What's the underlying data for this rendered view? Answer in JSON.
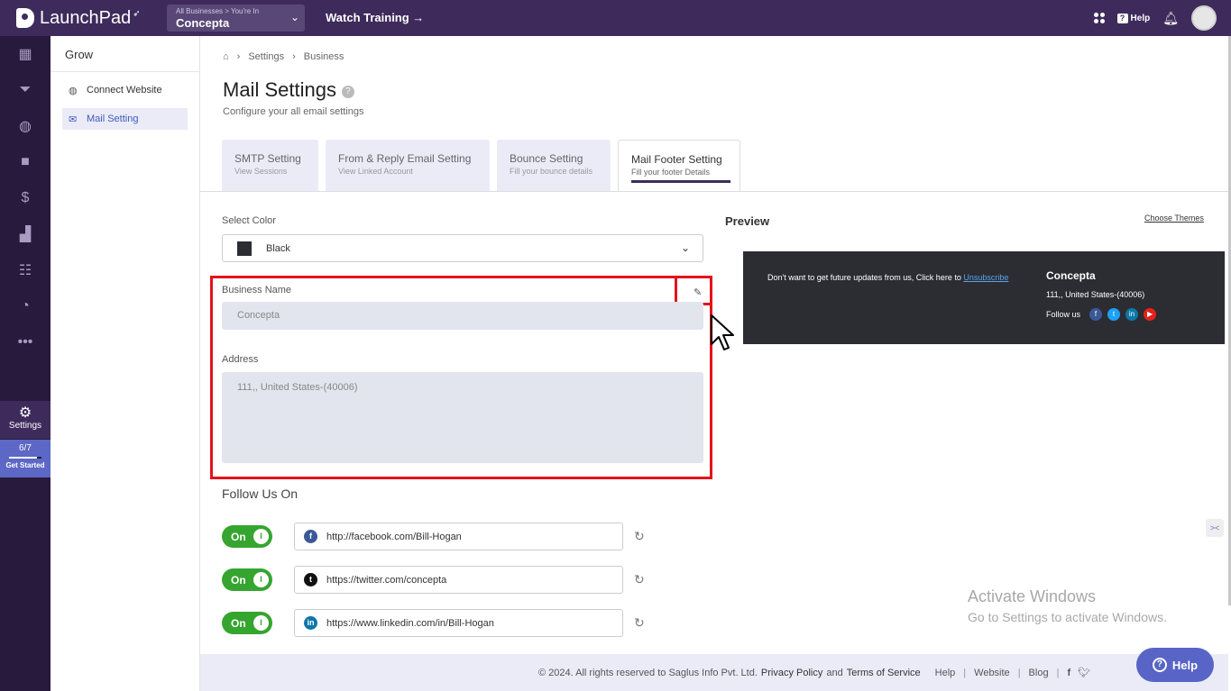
{
  "app": {
    "logo_text": "LaunchPad",
    "business_selector": {
      "caption": "All Businesses > You're In",
      "value": "Concepta"
    },
    "watch_training": "Watch Training →",
    "help_label": "Help"
  },
  "rail": {
    "settings_label": "Settings",
    "progress": "6/7",
    "progress_fraction": 0.857,
    "get_started": "Get Started"
  },
  "sidebar": {
    "title": "Grow",
    "items": [
      {
        "label": "Connect Website",
        "icon": "globe-icon"
      },
      {
        "label": "Mail Setting",
        "icon": "mail-icon"
      }
    ]
  },
  "breadcrumb": {
    "items": [
      "Settings",
      "Business"
    ]
  },
  "page": {
    "title": "Mail Settings",
    "subtitle": "Configure your all email settings"
  },
  "tabs": [
    {
      "title": "SMTP Setting",
      "sub": "View Sessions"
    },
    {
      "title": "From & Reply Email Setting",
      "sub": "View Linked Account"
    },
    {
      "title": "Bounce Setting",
      "sub": "Fill your bounce details"
    },
    {
      "title": "Mail Footer Setting",
      "sub": "Fill your footer Details"
    }
  ],
  "form": {
    "select_color_label": "Select Color",
    "select_color_value": "Black",
    "business_name_label": "Business Name",
    "business_name_value": "Concepta",
    "address_label": "Address",
    "address_value": "111,, United States-(40006)",
    "follow_title": "Follow Us On",
    "toggle_label": "On",
    "socials": [
      {
        "url": "http://facebook.com/Bill-Hogan",
        "icon": "facebook-icon",
        "color": "#3b5998"
      },
      {
        "url": "https://twitter.com/concepta",
        "icon": "twitter-icon",
        "color": "#111111"
      },
      {
        "url": "https://www.linkedin.com/in/Bill-Hogan",
        "icon": "linkedin-icon",
        "color": "#0e76a8"
      }
    ]
  },
  "preview": {
    "title": "Preview",
    "choose_themes": "Choose Themes",
    "unsubscribe_text": "Don't want to get future updates from us, Click here to",
    "unsubscribe_link": "Unsubscribe",
    "business_name": "Concepta",
    "address": "111,, United States-(40006)",
    "follow_us": "Follow us"
  },
  "footer": {
    "copyright": "© 2024. All rights reserved to Saglus Info Pvt. Ltd.",
    "privacy": "Privacy Policy",
    "and": "and",
    "terms": "Terms of Service",
    "links": [
      "Help",
      "Website",
      "Blog"
    ]
  },
  "watermark": {
    "line1": "Activate Windows",
    "line2": "Go to Settings to activate Windows."
  },
  "help_button": "Help"
}
